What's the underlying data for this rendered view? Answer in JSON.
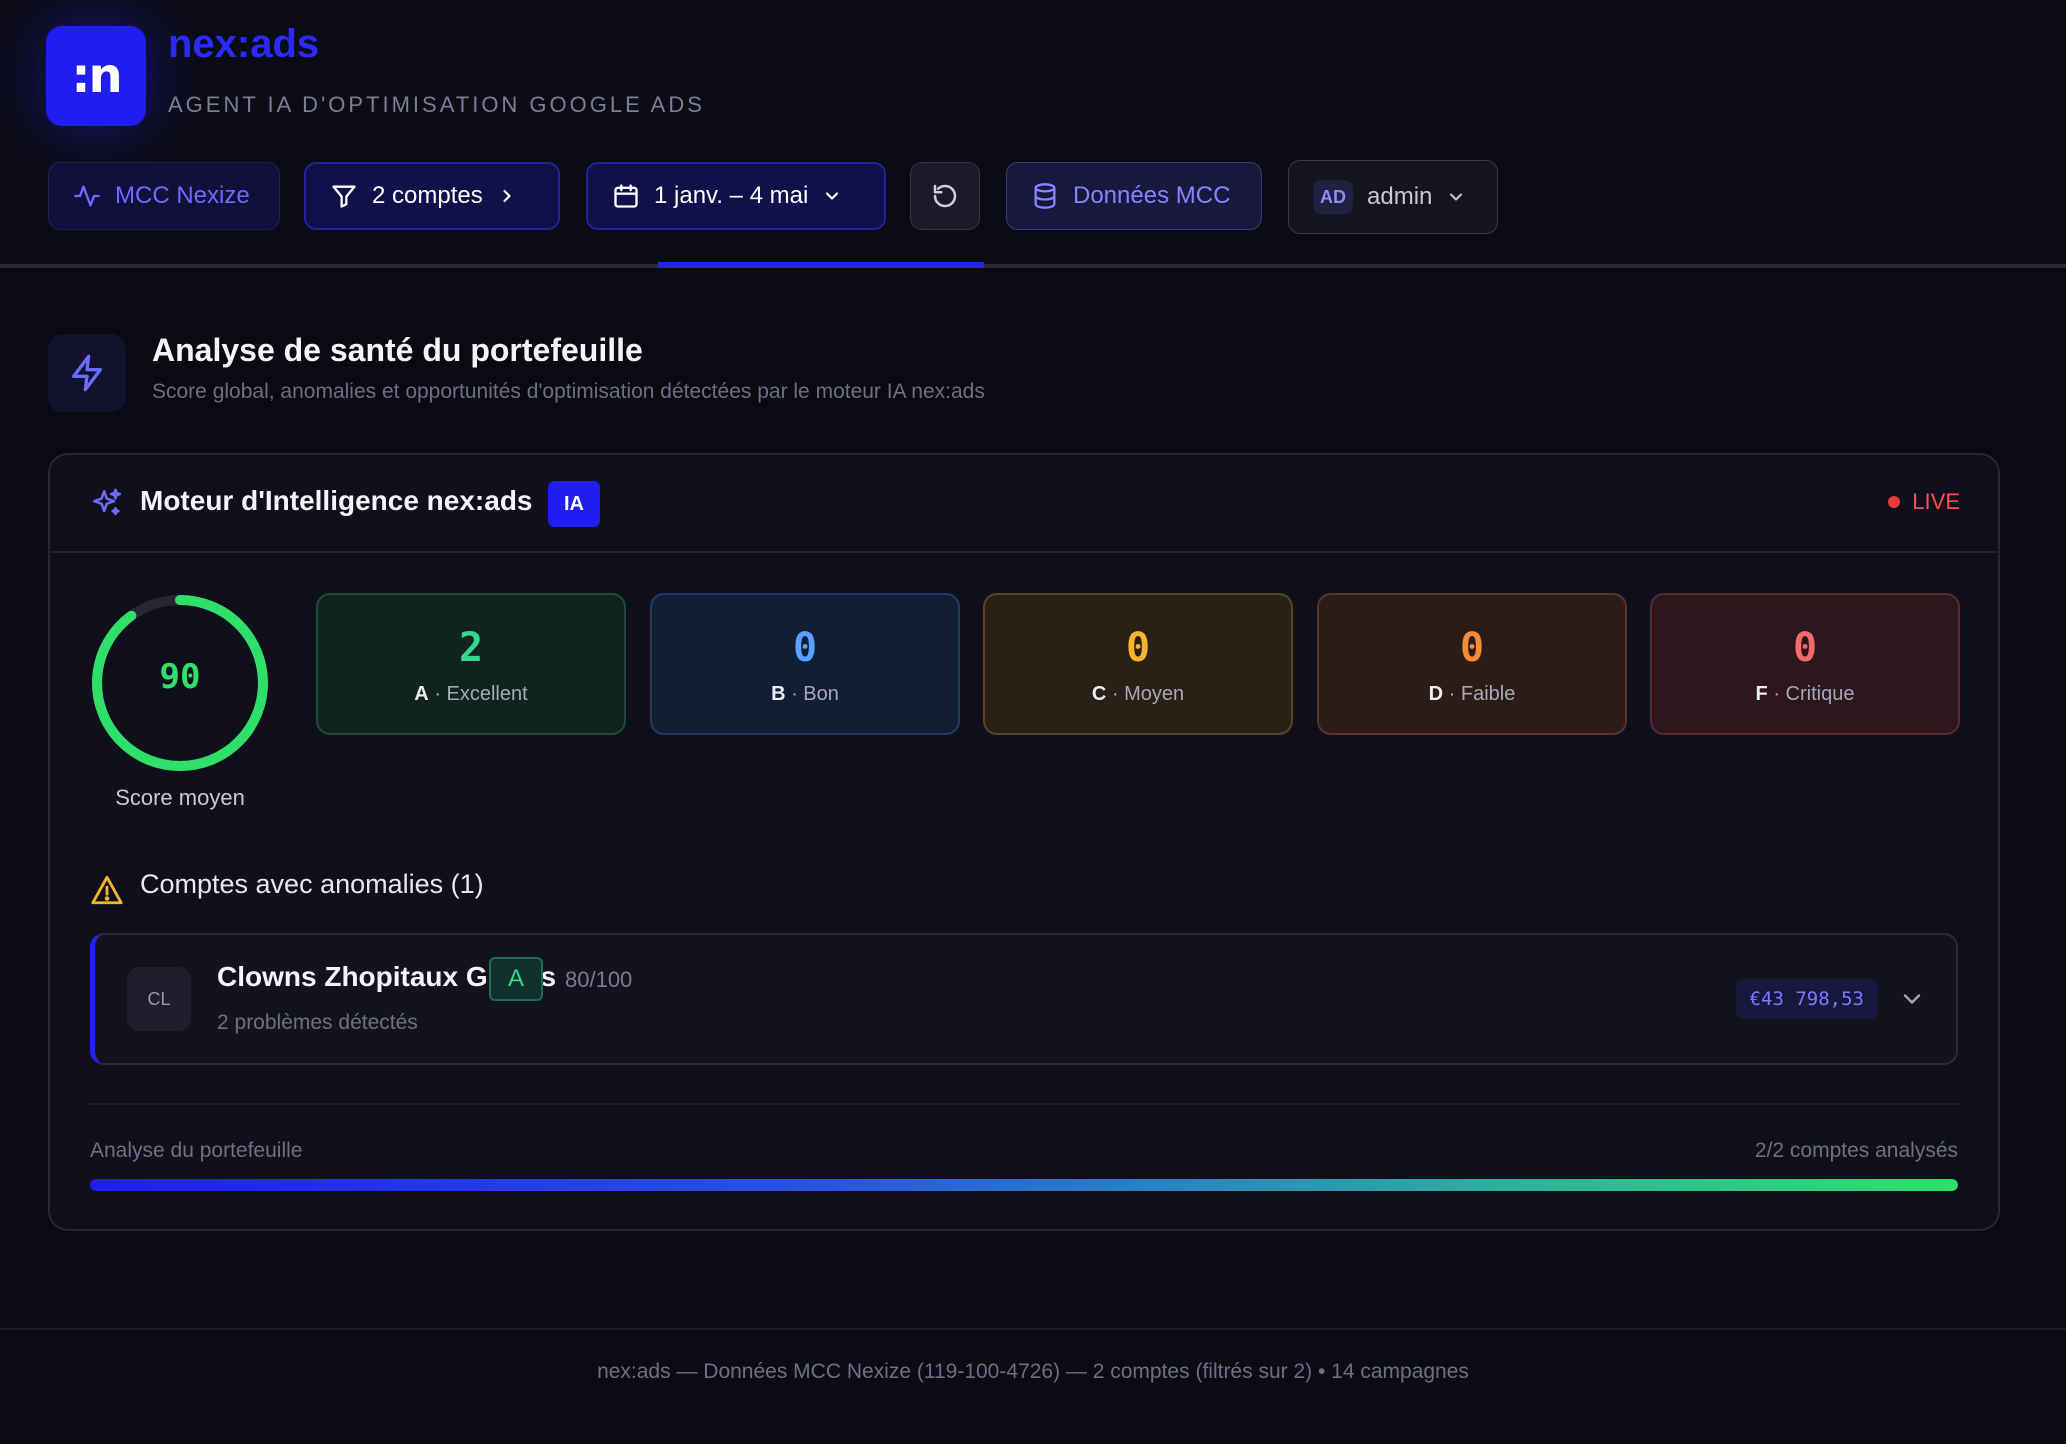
{
  "brand": {
    "logo_text": ":n",
    "name": "nex:ads",
    "subtitle": "AGENT IA D'OPTIMISATION GOOGLE ADS"
  },
  "toolbar": {
    "mcc_label": "MCC Nexize",
    "accounts_label": "2 comptes",
    "date_label": "1 janv. – 4 mai",
    "data_label": "Données MCC",
    "user_initials": "AD",
    "user_name": "admin"
  },
  "section": {
    "title": "Analyse de santé du portefeuille",
    "subtitle": "Score global, anomalies et opportunités d'optimisation détectées par le moteur IA nex:ads"
  },
  "engine": {
    "title": "Moteur d'Intelligence nex:ads",
    "badge": "IA",
    "status": "LIVE",
    "score_value": "90",
    "score_fraction": 0.9,
    "score_label": "Score moyen",
    "grades": [
      {
        "count": "2",
        "letter": "A",
        "label": "· Excellent"
      },
      {
        "count": "0",
        "letter": "B",
        "label": "· Bon"
      },
      {
        "count": "0",
        "letter": "C",
        "label": "· Moyen"
      },
      {
        "count": "0",
        "letter": "D",
        "label": "· Faible"
      },
      {
        "count": "0",
        "letter": "F",
        "label": "· Critique"
      }
    ]
  },
  "anomalies": {
    "title": "Comptes avec anomalies (1)",
    "accounts": [
      {
        "initials": "CL",
        "name": "Clowns Zhopitaux Grants",
        "grade": "A",
        "score": "80/100",
        "issues": "2 problèmes détectés",
        "amount": "€43 798,53"
      }
    ]
  },
  "progress": {
    "label": "Analyse du portefeuille",
    "count": "2/2 comptes analysés",
    "fraction": 1.0
  },
  "footer": {
    "text": "nex:ads — Données MCC Nexize (119-100-4726) — 2 comptes (filtrés sur 2) • 14 campagnes"
  },
  "colors": {
    "accent": "#1f1df0",
    "score_green": "#2ee06a",
    "live_red": "#ff4d4d"
  }
}
